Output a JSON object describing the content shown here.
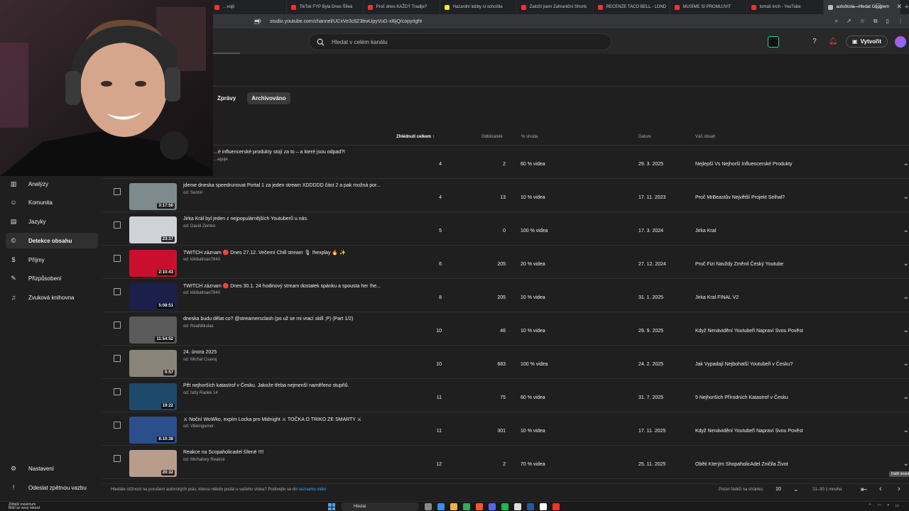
{
  "browser": {
    "tabs": [
      {
        "label": "…vojil"
      },
      {
        "label": "TikTok FYP Byla Dnes Šíleá"
      },
      {
        "label": "Proč dnes KAŽDÝ Tradije?"
      },
      {
        "label": "Hazardní lobby si ochočila"
      },
      {
        "label": "Založil jsem Zahraniční Shorts"
      },
      {
        "label": "RECENZE TACO BELL - LOND"
      },
      {
        "label": "MUSÍME SI PROMLUVIT"
      },
      {
        "label": "tomáš krch - YouTube"
      },
      {
        "label": "autoškola - Hledat Googlem"
      }
    ],
    "url": "studio.youtube.com/channel/UCxVe3c8Z3bwUpyVuG-xl6jQ/copyright"
  },
  "header": {
    "search_placeholder": "Hledat v celém kanálu",
    "create_label": "Vytvořit"
  },
  "chips": [
    "Zprávy",
    "Archivováno"
  ],
  "columns": {
    "views": "Zhlédnutí celkem",
    "subs": "Odběratelé",
    "match": "% shoda",
    "date": "Datum",
    "content": "Váš obsah"
  },
  "sidebar": {
    "items": [
      {
        "label": "Analýzy",
        "icon": "analytics-icon"
      },
      {
        "label": "Komunita",
        "icon": "community-icon"
      },
      {
        "label": "Jazyky",
        "icon": "subtitles-icon"
      },
      {
        "label": "Detekce obsahu",
        "icon": "copyright-icon"
      },
      {
        "label": "Příjmy",
        "icon": "monetization-icon"
      },
      {
        "label": "Přizpůsobení",
        "icon": "customization-icon"
      },
      {
        "label": "Zvuková knihovna",
        "icon": "audio-library-icon"
      }
    ],
    "bottom": [
      {
        "label": "Nastavení",
        "icon": "settings-icon"
      },
      {
        "label": "Odeslat zpětnou vazbu",
        "icon": "feedback-icon"
      }
    ]
  },
  "rows": [
    {
      "title": "…é influencerské produkty stojí za to – a které jsou odpad?!",
      "by": "…aguje",
      "duration": "",
      "views": "4",
      "subs": "2",
      "match": "60 % videa",
      "date": "29. 3. 2025",
      "content": "Nejlepší Vs Nejhorší Influencerské Produkty",
      "thumb": "#444444"
    },
    {
      "title": "jdeme dneska speedrunovat Portal 1 za jeden stream XDDDDD část 2 a pak možná por...",
      "by": "od: Semirr",
      "duration": "3:17:50",
      "views": "4",
      "subs": "13",
      "match": "10 % videa",
      "date": "17. 11. 2023",
      "content": "Proč MrBeastův Největší Projekt Selhal?",
      "thumb": "#7f8a8e"
    },
    {
      "title": "Jirka Král byl jeden z nejpopulárnějších Youtuberů u nás.",
      "by": "od: David Zemko",
      "duration": "23:17",
      "views": "5",
      "subs": "0",
      "match": "100 % videa",
      "date": "17. 3. 2024",
      "content": "Jirka Kral",
      "thumb": "#cfd3d8"
    },
    {
      "title": "TWITCH záznam 🔴 Dnes 27.12. Večerní Chill stream 🎙 !hexplay 🔥 ✨",
      "by": "od: kikibatman7840",
      "duration": "2:10:43",
      "views": "6",
      "subs": "205",
      "match": "20 % videa",
      "date": "27. 12. 2024",
      "content": "Proč Fizi Navždy Změnil Český Youtube",
      "thumb": "#c8102e"
    },
    {
      "title": "TWITCH záznam 🔴 Dnes 30.1. 24 hodinový stream dostatek spánku a spousta her !he...",
      "by": "od: kikibatman7840",
      "duration": "5:08:51",
      "views": "8",
      "subs": "205",
      "match": "10 % videa",
      "date": "31. 1. 2025",
      "content": "Jirka Kral FINAL V2",
      "thumb": "#1b1f4a"
    },
    {
      "title": "dneska budu dělat co? @streamersclash (ps už se mi vrací skill ;P) (Part 1/2)",
      "by": "od: RealMikulas",
      "duration": "11:54:52",
      "views": "10",
      "subs": "46",
      "match": "10 % videa",
      "date": "29. 9. 2025",
      "content": "Když Nenávidění Youtubeři Napraví Svou Pověst",
      "thumb": "#5a5a5a"
    },
    {
      "title": "24. února 2025",
      "by": "od: Michal Csavoj",
      "duration": "0:57",
      "views": "10",
      "subs": "683",
      "match": "100 % videa",
      "date": "24. 2. 2025",
      "content": "Jak Vypadají Nejbohatší Youtubeři v Česku?",
      "thumb": "#8a8578"
    },
    {
      "title": "Pět nejhorších katastrof v Česku. Jakože třeba nejmenší naměřeno stupňů.",
      "by": "od: fatty Radek 14",
      "duration": "19:22",
      "views": "11",
      "subs": "75",
      "match": "60 % videa",
      "date": "31. 7. 2025",
      "content": "5 Nejhorších Přírodních Katastrof v Česku",
      "thumb": "#1d4a6b"
    },
    {
      "title": "⚔ Noční WoWko, expím Locka pro Midnight ⚔ TOČKA O TRIKO ZE SMARTY ⚔",
      "by": "od: Vikkingamer",
      "duration": "8:10:38",
      "views": "11",
      "subs": "301",
      "match": "10 % videa",
      "date": "17. 11. 2025",
      "content": "Když Nenávidění Youtubeři Napraví Svou Pověst",
      "thumb": "#2b4f8a"
    },
    {
      "title": "Reakce na Scopaholicadel šílené !!!!",
      "by": "od: Michalovy Reakce",
      "duration": "20:32",
      "views": "12",
      "subs": "2",
      "match": "70 % videa",
      "date": "25. 11. 2025",
      "content": "Oběti Kterým ShopaholicAdel Zničila Život",
      "thumb": "#b89c8c"
    }
  ],
  "footer": {
    "text": "Hledáte stížnost na porušení autorských práv, kterou někdo podal u vašeho videa? Podívejte se do",
    "link": "seznamu videí",
    "rows_label": "Počet řádků na stránku:",
    "rows_value": "10",
    "range": "21–30 z mnoha",
    "tooltip": "Další stránka"
  },
  "taskbar": {
    "weather_line1": "Zítřejší maximum",
    "weather_line2": "Blíží se nový rekord",
    "search": "Hledat"
  }
}
